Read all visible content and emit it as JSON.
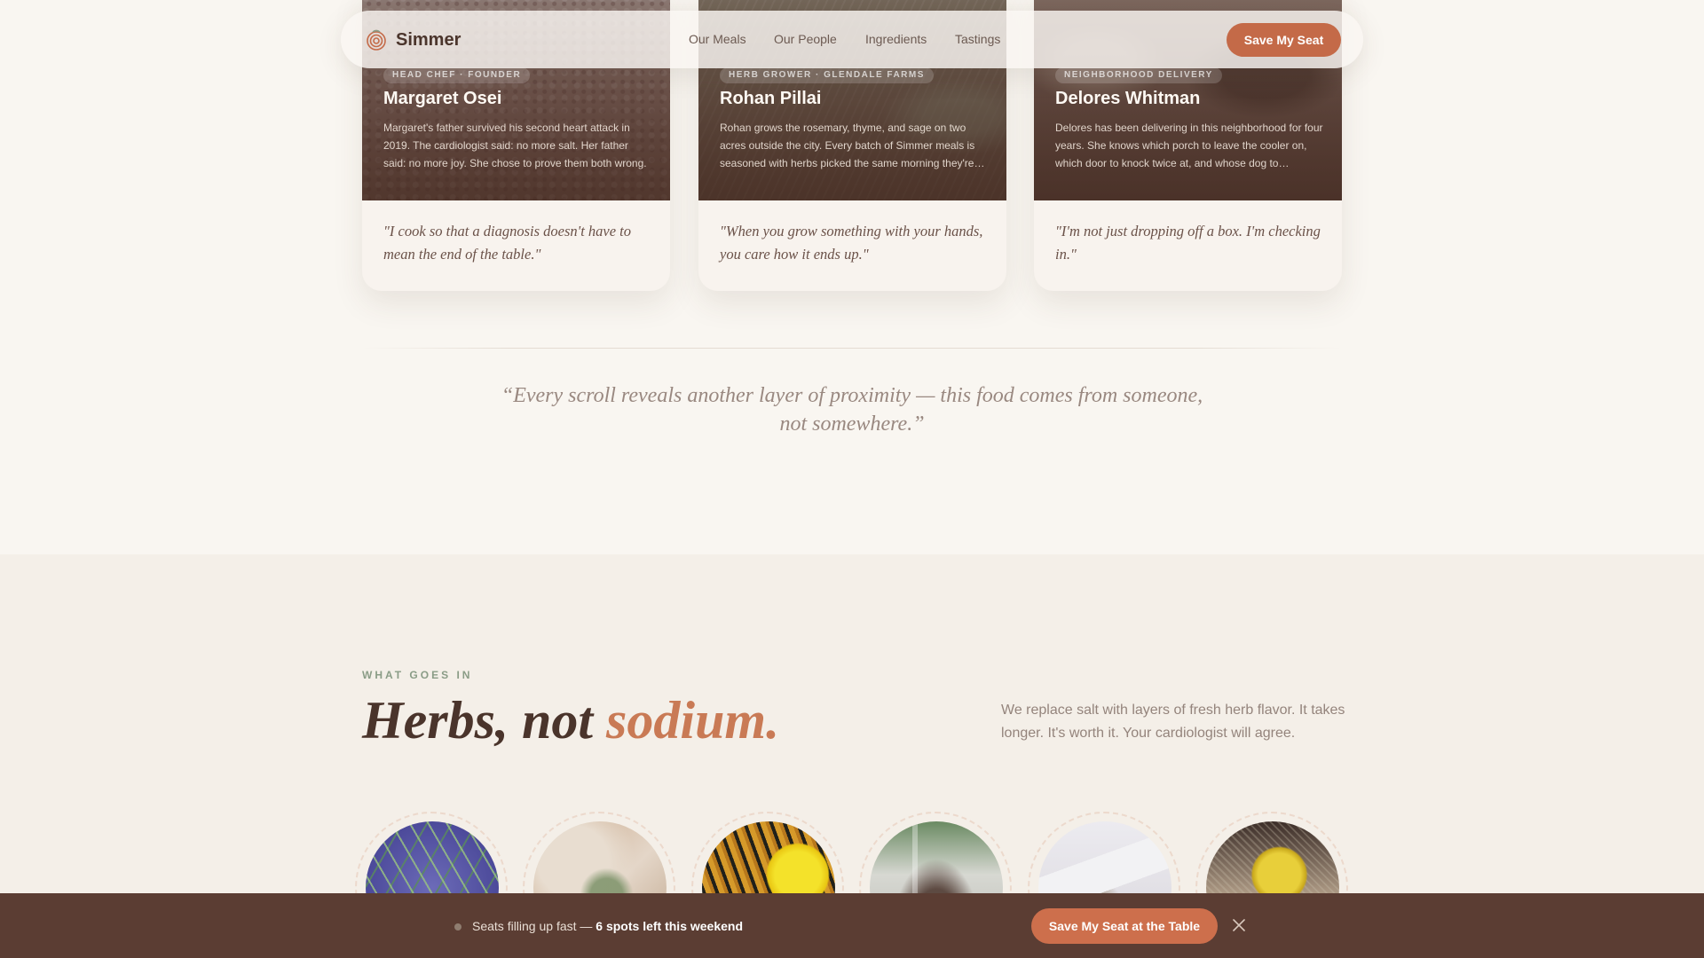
{
  "nav": {
    "brand": "Simmer",
    "links": [
      "Our Meals",
      "Our People",
      "Ingredients",
      "Tastings"
    ],
    "cta": "Save My Seat"
  },
  "people": [
    {
      "tag": "HEAD CHEF · FOUNDER",
      "name": "Margaret Osei",
      "bio": "Margaret's father survived his second heart attack in 2019. The cardiologist said: no more salt. Her father said: no more joy. She chose to prove them both wrong.",
      "quote": "\"I cook so that a diagnosis doesn't have to mean the end of the table.\""
    },
    {
      "tag": "HERB GROWER · GLENDALE FARMS",
      "name": "Rohan Pillai",
      "bio": "Rohan grows the rosemary, thyme, and sage on two acres outside the city. Every batch of Simmer meals is seasoned with herbs picked the same morning they're…",
      "quote": "\"When you grow something with your hands, you care how it ends up.\""
    },
    {
      "tag": "NEIGHBORHOOD DELIVERY",
      "name": "Delores Whitman",
      "bio": "Delores has been delivering in this neighborhood for four years. She knows which porch to leave the cooler on, which door to knock twice at, and whose dog to…",
      "quote": "\"I'm not just dropping off a box. I'm checking in.\""
    }
  ],
  "pull_quote": "“Every scroll reveals another layer of proximity — this food comes from someone, not somewhere.”",
  "ingredients": {
    "eyebrow": "WHAT GOES IN",
    "headline_main": "Herbs, not ",
    "headline_accent": "sodium.",
    "lede": "We replace salt with layers of fresh herb flavor. It takes longer. It's worth it. Your cardiologist will agree.",
    "items": [
      "rosemary",
      "thyme",
      "turmeric-lemon",
      "spice-jar",
      "garlic",
      "lemon-zest"
    ]
  },
  "sticky": {
    "text": "Seats filling up fast — ",
    "highlight": "6 spots left this weekend",
    "cta": "Save My Seat at the Table"
  },
  "colors": {
    "accent": "#c46a48",
    "headline_accent": "#c97a55",
    "sticky_bg": "#5b3d33",
    "eyebrow": "#8a9c86"
  }
}
